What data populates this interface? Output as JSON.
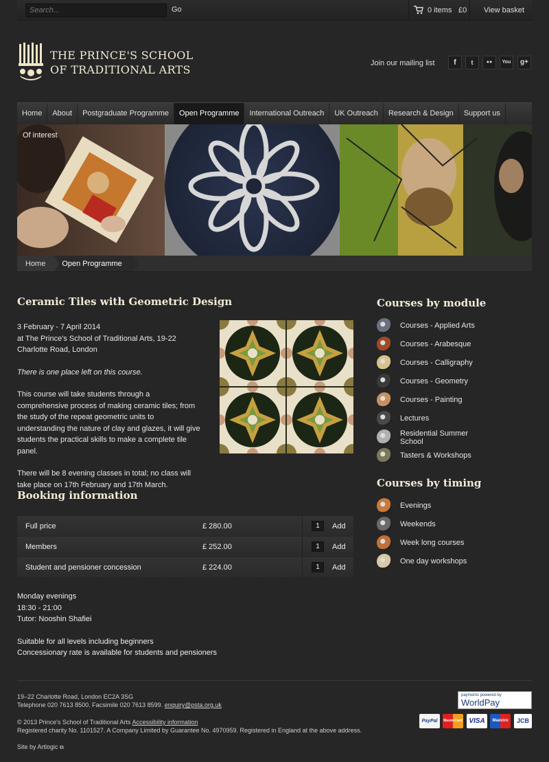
{
  "topbar": {
    "search_placeholder": "Search...",
    "go_label": "Go",
    "basket_count": "0 items",
    "basket_total": "£0",
    "view_basket": "View basket"
  },
  "header": {
    "logo_line1": "THE PRINCE'S SCHOOL",
    "logo_line2": "OF TRADITIONAL ARTS",
    "mailing_list": "Join our mailing list",
    "social": [
      {
        "icon": "facebook-icon",
        "glyph": "f"
      },
      {
        "icon": "twitter-icon",
        "glyph": "t"
      },
      {
        "icon": "flickr-icon",
        "glyph": "●●"
      },
      {
        "icon": "youtube-icon",
        "glyph": "You"
      },
      {
        "icon": "googleplus-icon",
        "glyph": "g+"
      }
    ]
  },
  "nav": {
    "items": [
      "Home",
      "About",
      "Postgraduate Programme",
      "Open Programme",
      "International Outreach",
      "UK Outreach",
      "Research & Design",
      "Support us"
    ],
    "active": "Open Programme",
    "sub_link": "Of interest"
  },
  "breadcrumb": {
    "home": "Home",
    "current": "Open Programme"
  },
  "course": {
    "title": "Ceramic Tiles with Geometric Design",
    "dates": "3 February - 7 April 2014",
    "location_line1": "at The Prince's School of Traditional Arts, 19-22",
    "location_line2": "Charlotte Road, London",
    "places_note": "There is one place left on this course.",
    "description": "This course will take students through a comprehensive process of making ceramic tiles; from the study of the repeat geometric units to understanding the nature of clay and glazes, it will give students the practical skills to make a complete tile panel.",
    "classes_note": "There will be 8 evening classes in total; no class will take place on 17th February and 17th March."
  },
  "booking": {
    "title": "Booking information",
    "rows": [
      {
        "name": "Full price",
        "price": "£ 280.00",
        "qty": "1",
        "add": "Add"
      },
      {
        "name": "Members",
        "price": "£ 252.00",
        "qty": "1",
        "add": "Add"
      },
      {
        "name": "Student and pensioner concession",
        "price": "£ 224.00",
        "qty": "1",
        "add": "Add"
      }
    ]
  },
  "schedule": {
    "day": "Monday evenings",
    "time": "18:30 - 21:00",
    "tutor": "Tutor: Nooshin Shafiei",
    "levels": "Suitable for all levels including beginners",
    "concession": "Concessionary rate is available for students and pensioners"
  },
  "sidebar": {
    "module_title": "Courses by module",
    "modules": [
      {
        "label": "Courses - Applied Arts",
        "color": "#6b7080"
      },
      {
        "label": "Courses - Arabesque",
        "color": "#a04a2a"
      },
      {
        "label": "Courses - Calligraphy",
        "color": "#d9c28a"
      },
      {
        "label": "Courses - Geometry",
        "color": "#3a3a3a"
      },
      {
        "label": "Courses - Painting",
        "color": "#c89060"
      },
      {
        "label": "Lectures",
        "color": "#4a4a4a"
      },
      {
        "label": "Residential Summer School",
        "color": "#b0b0b0"
      },
      {
        "label": "Tasters & Workshops",
        "color": "#7a7a5a"
      }
    ],
    "timing_title": "Courses by timing",
    "timings": [
      {
        "label": "Evenings",
        "color": "#c87a3a"
      },
      {
        "label": "Weekends",
        "color": "#6a6a6a"
      },
      {
        "label": "Week long courses",
        "color": "#c0703a"
      },
      {
        "label": "One day workshops",
        "color": "#d8c8a8"
      }
    ]
  },
  "footer": {
    "address": "19–22 Charlotte Road, London EC2A 3SG",
    "phone": "Telephone 020 7613 8500. Facsimile 020 7613 8599.",
    "email": "enquiry@psta.org.uk",
    "copyright": "© 2013 Prince's School of Traditional Arts",
    "accessibility": "Accessibility information",
    "registered": "Registered charity No. 1101527. A Company Limited by Guarantee No. 4970959. Registered in England at the above address.",
    "site_by": "Site by Artlogic",
    "worldpay_small": "payments powered by",
    "worldpay_big": "WorldPay",
    "cards": [
      "PayPal",
      "MasterCard",
      "VISA",
      "Maestro",
      "JCB"
    ]
  }
}
